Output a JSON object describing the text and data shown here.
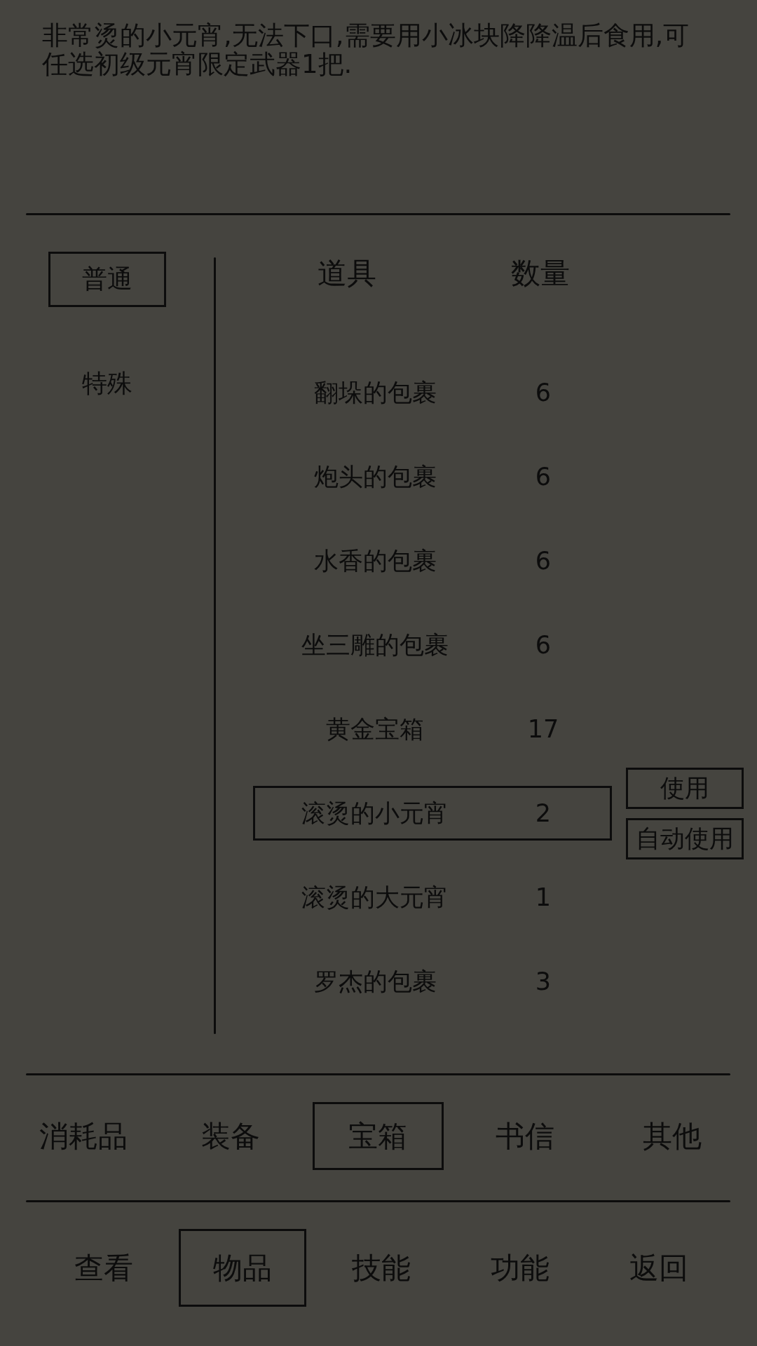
{
  "description": "非常烫的小元宵,无法下口,需要用小冰块降降温后食用,可任选初级元宵限定武器1把.",
  "sidebar": {
    "items": [
      {
        "label": "普通",
        "selected": true
      },
      {
        "label": "特殊",
        "selected": false
      }
    ]
  },
  "table": {
    "columns": [
      "道具",
      "数量"
    ],
    "rows": [
      {
        "name": "翻垛的包裹",
        "count": "6",
        "selected": false
      },
      {
        "name": "炮头的包裹",
        "count": "6",
        "selected": false
      },
      {
        "name": "水香的包裹",
        "count": "6",
        "selected": false
      },
      {
        "name": "坐三雕的包裹",
        "count": "6",
        "selected": false
      },
      {
        "name": "黄金宝箱",
        "count": "17",
        "selected": false
      },
      {
        "name": "滚烫的小元宵",
        "count": "2",
        "selected": true
      },
      {
        "name": "滚烫的大元宵",
        "count": "1",
        "selected": false
      },
      {
        "name": "罗杰的包裹",
        "count": "3",
        "selected": false
      }
    ],
    "row_actions": [
      "使用",
      "自动使用"
    ]
  },
  "categories": [
    {
      "label": "消耗品",
      "selected": false
    },
    {
      "label": "装备",
      "selected": false
    },
    {
      "label": "宝箱",
      "selected": true
    },
    {
      "label": "书信",
      "selected": false
    },
    {
      "label": "其他",
      "selected": false
    }
  ],
  "nav": [
    {
      "label": "查看",
      "selected": false
    },
    {
      "label": "物品",
      "selected": true
    },
    {
      "label": "技能",
      "selected": false
    },
    {
      "label": "功能",
      "selected": false
    },
    {
      "label": "返回",
      "selected": false
    }
  ]
}
